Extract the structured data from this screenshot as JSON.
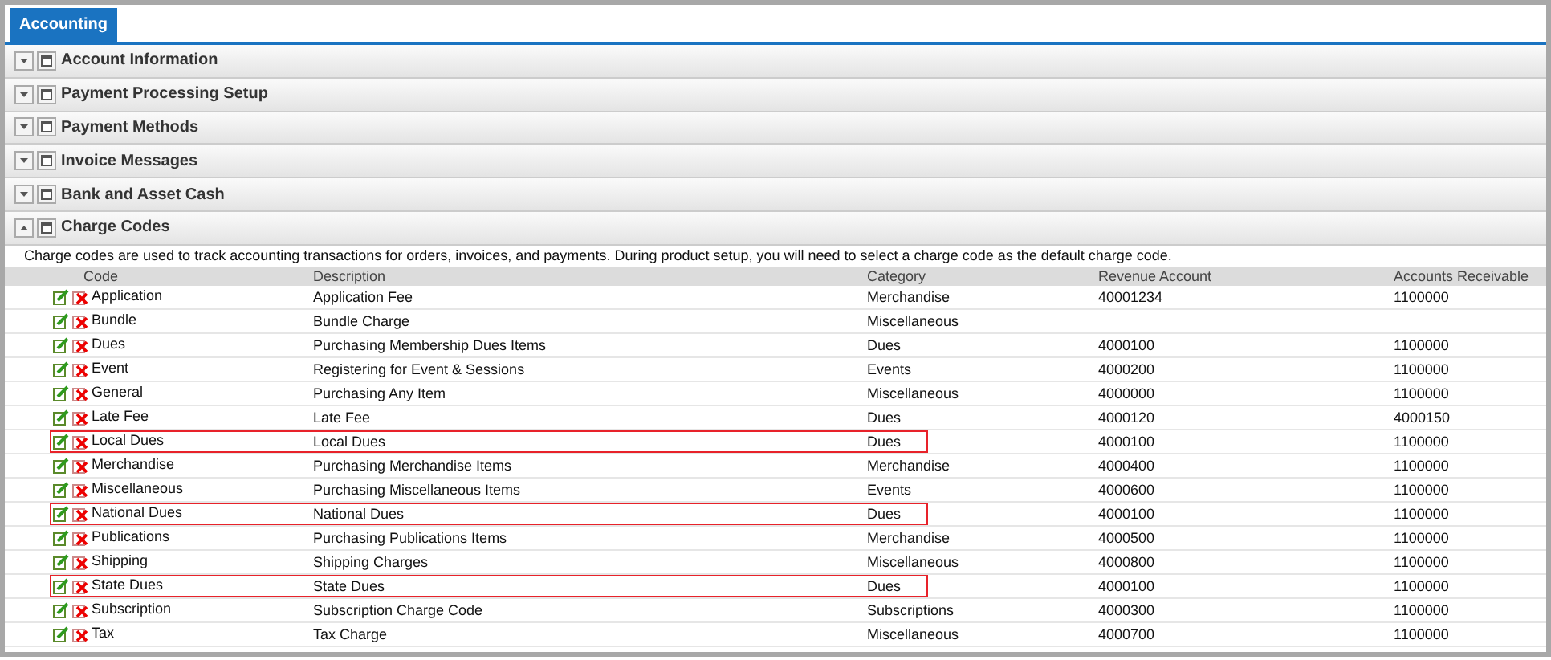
{
  "tabs": [
    {
      "label": "Accounting",
      "selected": true
    }
  ],
  "sections": [
    {
      "title": "Account Information",
      "expanded": false
    },
    {
      "title": "Payment Processing Setup",
      "expanded": false
    },
    {
      "title": "Payment Methods",
      "expanded": false
    },
    {
      "title": "Invoice Messages",
      "expanded": false
    },
    {
      "title": "Bank and Asset Cash",
      "expanded": false
    },
    {
      "title": "Charge Codes",
      "expanded": true
    }
  ],
  "charge_codes": {
    "description": "Charge codes are used to track accounting transactions for orders, invoices, and payments. During product setup, you will need to select a charge code as the default charge code.",
    "columns": [
      "Code",
      "Description",
      "Category",
      "Revenue Account",
      "Accounts Receivable"
    ],
    "rows": [
      {
        "code": "Application",
        "description": "Application Fee",
        "category": "Merchandise",
        "revenue_account": "40001234",
        "accounts_receivable": "1100000",
        "highlighted": false
      },
      {
        "code": "Bundle",
        "description": "Bundle Charge",
        "category": "Miscellaneous",
        "highlighted": false
      },
      {
        "code": "Dues",
        "description": "Purchasing Membership Dues Items",
        "category": "Dues",
        "revenue_account": "4000100",
        "accounts_receivable": "1100000",
        "highlighted": false
      },
      {
        "code": "Event",
        "description": "Registering for Event & Sessions",
        "category": "Events",
        "revenue_account": "4000200",
        "accounts_receivable": "1100000",
        "highlighted": false
      },
      {
        "code": "General",
        "description": "Purchasing Any Item",
        "category": "Miscellaneous",
        "revenue_account": "4000000",
        "accounts_receivable": "1100000",
        "highlighted": false
      },
      {
        "code": "Late Fee",
        "description": "Late Fee",
        "category": "Dues",
        "revenue_account": "4000120",
        "accounts_receivable": "4000150",
        "highlighted": false
      },
      {
        "code": "Local Dues",
        "description": "Local Dues",
        "category": "Dues",
        "revenue_account": "4000100",
        "accounts_receivable": "1100000",
        "highlighted": true
      },
      {
        "code": "Merchandise",
        "description": "Purchasing Merchandise Items",
        "category": "Merchandise",
        "revenue_account": "4000400",
        "accounts_receivable": "1100000",
        "highlighted": false
      },
      {
        "code": "Miscellaneous",
        "description": "Purchasing Miscellaneous Items",
        "category": "Events",
        "revenue_account": "4000600",
        "accounts_receivable": "1100000",
        "highlighted": false
      },
      {
        "code": "National Dues",
        "description": "National Dues",
        "category": "Dues",
        "revenue_account": "4000100",
        "accounts_receivable": "1100000",
        "highlighted": true
      },
      {
        "code": "Publications",
        "description": "Purchasing Publications Items",
        "category": "Merchandise",
        "revenue_account": "4000500",
        "accounts_receivable": "1100000",
        "highlighted": false
      },
      {
        "code": "Shipping",
        "description": "Shipping Charges",
        "category": "Miscellaneous",
        "revenue_account": "4000800",
        "accounts_receivable": "1100000",
        "highlighted": false
      },
      {
        "code": "State Dues",
        "description": "State Dues",
        "category": "Dues",
        "revenue_account": "4000100",
        "accounts_receivable": "1100000",
        "highlighted": true
      },
      {
        "code": "Subscription",
        "description": "Subscription Charge Code",
        "category": "Subscriptions",
        "revenue_account": "4000300",
        "accounts_receivable": "1100000",
        "highlighted": false
      },
      {
        "code": "Tax",
        "description": "Tax Charge",
        "category": "Miscellaneous",
        "revenue_account": "4000700",
        "accounts_receivable": "1100000",
        "highlighted": false
      }
    ]
  }
}
